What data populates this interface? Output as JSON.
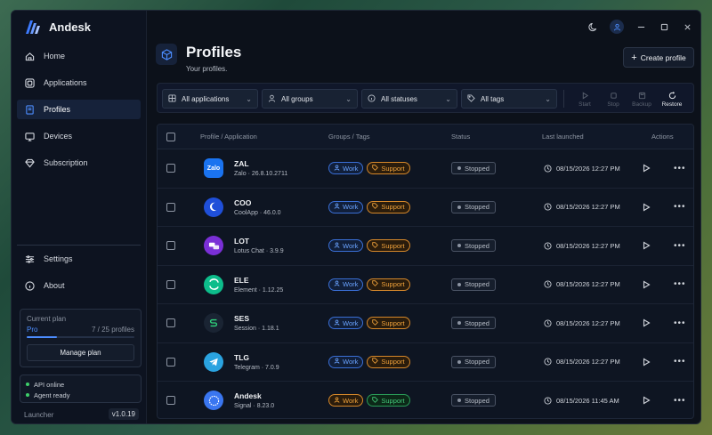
{
  "app": {
    "name": "Andesk"
  },
  "sidebar": {
    "nav": [
      {
        "id": "home",
        "label": "Home",
        "icon": "home-icon",
        "active": false
      },
      {
        "id": "applications",
        "label": "Applications",
        "icon": "applications-icon",
        "active": false
      },
      {
        "id": "profiles",
        "label": "Profiles",
        "icon": "profiles-icon",
        "active": true
      },
      {
        "id": "devices",
        "label": "Devices",
        "icon": "devices-icon",
        "active": false
      },
      {
        "id": "subscription",
        "label": "Subscription",
        "icon": "diamond-icon",
        "active": false
      }
    ],
    "nav_bottom": [
      {
        "id": "settings",
        "label": "Settings",
        "icon": "sliders-icon"
      },
      {
        "id": "about",
        "label": "About",
        "icon": "info-icon"
      }
    ],
    "plan": {
      "heading": "Current plan",
      "name": "Pro",
      "count": "7 / 25 profiles",
      "usage_fraction": 0.28,
      "manage_label": "Manage plan"
    },
    "status": [
      {
        "label": "API online"
      },
      {
        "label": "Agent ready"
      }
    ],
    "launcher_label": "Launcher",
    "version": "v1.0.19"
  },
  "header": {
    "title": "Profiles",
    "subtitle": "Your profiles.",
    "create_label": "Create profile"
  },
  "filters": [
    {
      "label": "All applications",
      "icon": "grid-icon"
    },
    {
      "label": "All groups",
      "icon": "user-icon"
    },
    {
      "label": "All statuses",
      "icon": "info-icon"
    },
    {
      "label": "All tags",
      "icon": "tag-icon"
    }
  ],
  "bulk_actions": [
    {
      "label": "Start",
      "icon": "play-icon",
      "enabled": false
    },
    {
      "label": "Stop",
      "icon": "stop-icon",
      "enabled": false
    },
    {
      "label": "Backup",
      "icon": "backup-icon",
      "enabled": false
    },
    {
      "label": "Restore",
      "icon": "restore-icon",
      "enabled": true
    }
  ],
  "table": {
    "columns": [
      "Profile / Application",
      "Groups / Tags",
      "Status",
      "Last launched",
      "Actions"
    ],
    "rows": [
      {
        "name": "ZAL",
        "app": "Zalo",
        "version": "26.8.10.2711",
        "icon_text": "Zalo",
        "icon_color": "#1a73f0",
        "tags": [
          {
            "label": "Work",
            "style": "blue"
          },
          {
            "label": "Support",
            "style": "orange"
          }
        ],
        "status": "Stopped",
        "launched": "08/15/2026 12:27 PM"
      },
      {
        "name": "COO",
        "app": "CoolApp",
        "version": "46.0.0",
        "icon_text": "",
        "icon_color": "#1f4fd9",
        "tags": [
          {
            "label": "Work",
            "style": "blue"
          },
          {
            "label": "Support",
            "style": "orange"
          }
        ],
        "status": "Stopped",
        "launched": "08/15/2026 12:27 PM"
      },
      {
        "name": "LOT",
        "app": "Lotus Chat",
        "version": "3.9.9",
        "icon_text": "",
        "icon_color": "#7a2fd6",
        "tags": [
          {
            "label": "Work",
            "style": "blue"
          },
          {
            "label": "Support",
            "style": "orange"
          }
        ],
        "status": "Stopped",
        "launched": "08/15/2026 12:27 PM"
      },
      {
        "name": "ELE",
        "app": "Element",
        "version": "1.12.25",
        "icon_text": "",
        "icon_color": "#0dbd8b",
        "tags": [
          {
            "label": "Work",
            "style": "blue"
          },
          {
            "label": "Support",
            "style": "orange"
          }
        ],
        "status": "Stopped",
        "launched": "08/15/2026 12:27 PM"
      },
      {
        "name": "SES",
        "app": "Session",
        "version": "1.18.1",
        "icon_text": "",
        "icon_color": "#1a2433",
        "tags": [
          {
            "label": "Work",
            "style": "blue"
          },
          {
            "label": "Support",
            "style": "orange"
          }
        ],
        "status": "Stopped",
        "launched": "08/15/2026 12:27 PM"
      },
      {
        "name": "TLG",
        "app": "Telegram",
        "version": "7.0.9",
        "icon_text": "",
        "icon_color": "#2aa3e0",
        "tags": [
          {
            "label": "Work",
            "style": "blue"
          },
          {
            "label": "Support",
            "style": "orange"
          }
        ],
        "status": "Stopped",
        "launched": "08/15/2026 12:27 PM"
      },
      {
        "name": "Andesk",
        "app": "Signal",
        "version": "8.23.0",
        "icon_text": "",
        "icon_color": "#3a76f0",
        "tags": [
          {
            "label": "Work",
            "style": "orange"
          },
          {
            "label": "Support",
            "style": "green"
          }
        ],
        "status": "Stopped",
        "launched": "08/15/2026 11:45 AM"
      }
    ]
  },
  "colors": {
    "accent": "#4c8dff",
    "background": "#0c111a",
    "online": "#3ecf6a"
  }
}
